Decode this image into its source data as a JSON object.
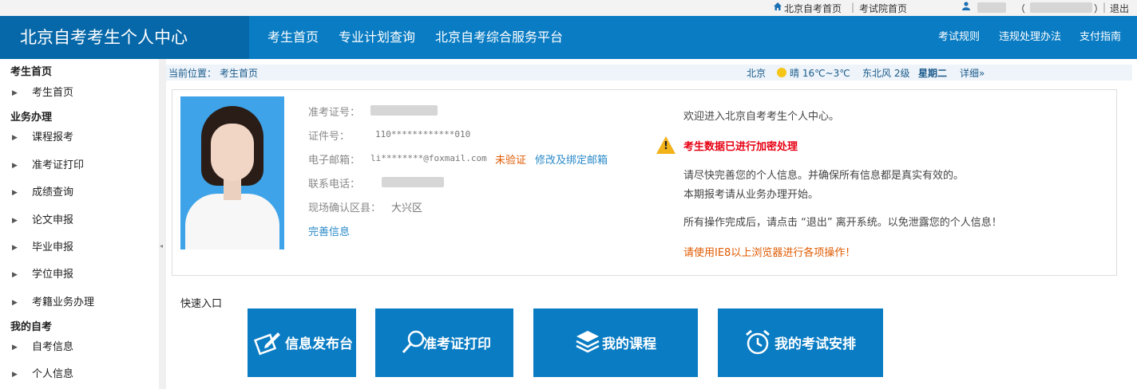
{
  "topbar": {
    "home_link": "北京自考首页",
    "exam_home_link": "考试院首页",
    "user_paren_open": "（",
    "user_paren_close": "）",
    "logout": "退出"
  },
  "header": {
    "title": "北京自考考生个人中心",
    "nav": [
      "考生首页",
      "专业计划查询",
      "北京自考综合服务平台"
    ],
    "right_nav": [
      "考试规则",
      "违规处理办法",
      "支付指南"
    ]
  },
  "sidebar": {
    "sections": [
      {
        "title": "考生首页",
        "items": [
          "考生首页"
        ]
      },
      {
        "title": "业务办理",
        "items": [
          "课程报考",
          "准考证打印",
          "成绩查询",
          "论文申报",
          "毕业申报",
          "学位申报",
          "考籍业务办理"
        ]
      },
      {
        "title": "我的自考",
        "items": [
          "自考信息",
          "个人信息"
        ]
      }
    ],
    "collapse_glyph": "◂"
  },
  "breadcrumb": {
    "label": "当前位置：",
    "current": "考生首页"
  },
  "weather": {
    "city": "北京",
    "condition": "晴 16℃~3℃",
    "wind": "东北风 2级",
    "weekday": "星期二",
    "detail_link": "详细»"
  },
  "profile": {
    "labels": {
      "exam_no": "准考证号：",
      "id_no": "证件号：",
      "email": "电子邮箱：",
      "phone": "联系电话：",
      "district": "现场确认区县："
    },
    "id_no_value": "110************010",
    "email_value": "li********@foxmail.com",
    "email_status": "未验证",
    "email_edit_link": "修改及绑定邮箱",
    "district_value": "大兴区",
    "complete_link": "完善信息"
  },
  "messages": {
    "welcome": "欢迎进入北京自考考生个人中心。",
    "encrypted_notice": "考生数据已进行加密处理",
    "warn_glyph": "!",
    "line1": "请尽快完善您的个人信息。并确保所有信息都是真实有效的。",
    "line2": "本期报考请从业务办理开始。",
    "line3": "所有操作完成后，请点击 “退出” 离开系统。以免泄露您的个人信息！",
    "browser_notice": "请使用IE8以上浏览器进行各项操作！"
  },
  "quick_entry": {
    "title": "快速入口",
    "buttons": [
      "信息发布台",
      "准考证打印",
      "我的课程",
      "我的考试安排"
    ]
  },
  "colors": {
    "header_blue": "#0a7cc3",
    "logo_blue": "#0768a9",
    "link_blue": "#2a8ac8",
    "warning_red": "#e60012",
    "status_orange": "#e05a00"
  }
}
